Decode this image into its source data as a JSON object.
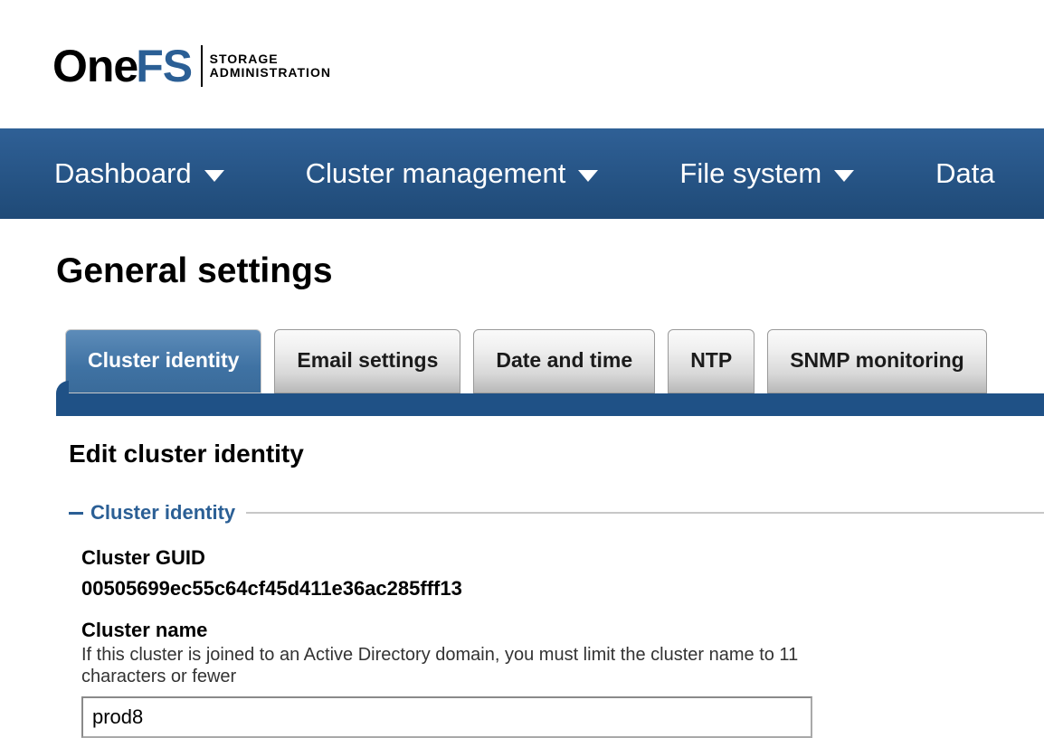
{
  "brand": {
    "one": "One",
    "fs": "FS",
    "sub1": "STORAGE",
    "sub2": "ADMINISTRATION"
  },
  "nav": {
    "items": [
      {
        "label": "Dashboard"
      },
      {
        "label": "Cluster management"
      },
      {
        "label": "File system"
      },
      {
        "label": "Data"
      }
    ]
  },
  "page": {
    "title": "General settings"
  },
  "tabs": [
    {
      "label": "Cluster identity",
      "active": true
    },
    {
      "label": "Email settings",
      "active": false
    },
    {
      "label": "Date and time",
      "active": false
    },
    {
      "label": "NTP",
      "active": false
    },
    {
      "label": "SNMP monitoring",
      "active": false
    }
  ],
  "form": {
    "heading": "Edit cluster identity",
    "legend": "Cluster identity",
    "guid_label": "Cluster GUID",
    "guid_value": "00505699ec55c64cf45d411e36ac285fff13",
    "name_label": "Cluster name",
    "name_hint": "If this cluster is joined to an Active Directory domain, you must limit the cluster name to 11 characters or fewer",
    "name_value": "prod8"
  }
}
